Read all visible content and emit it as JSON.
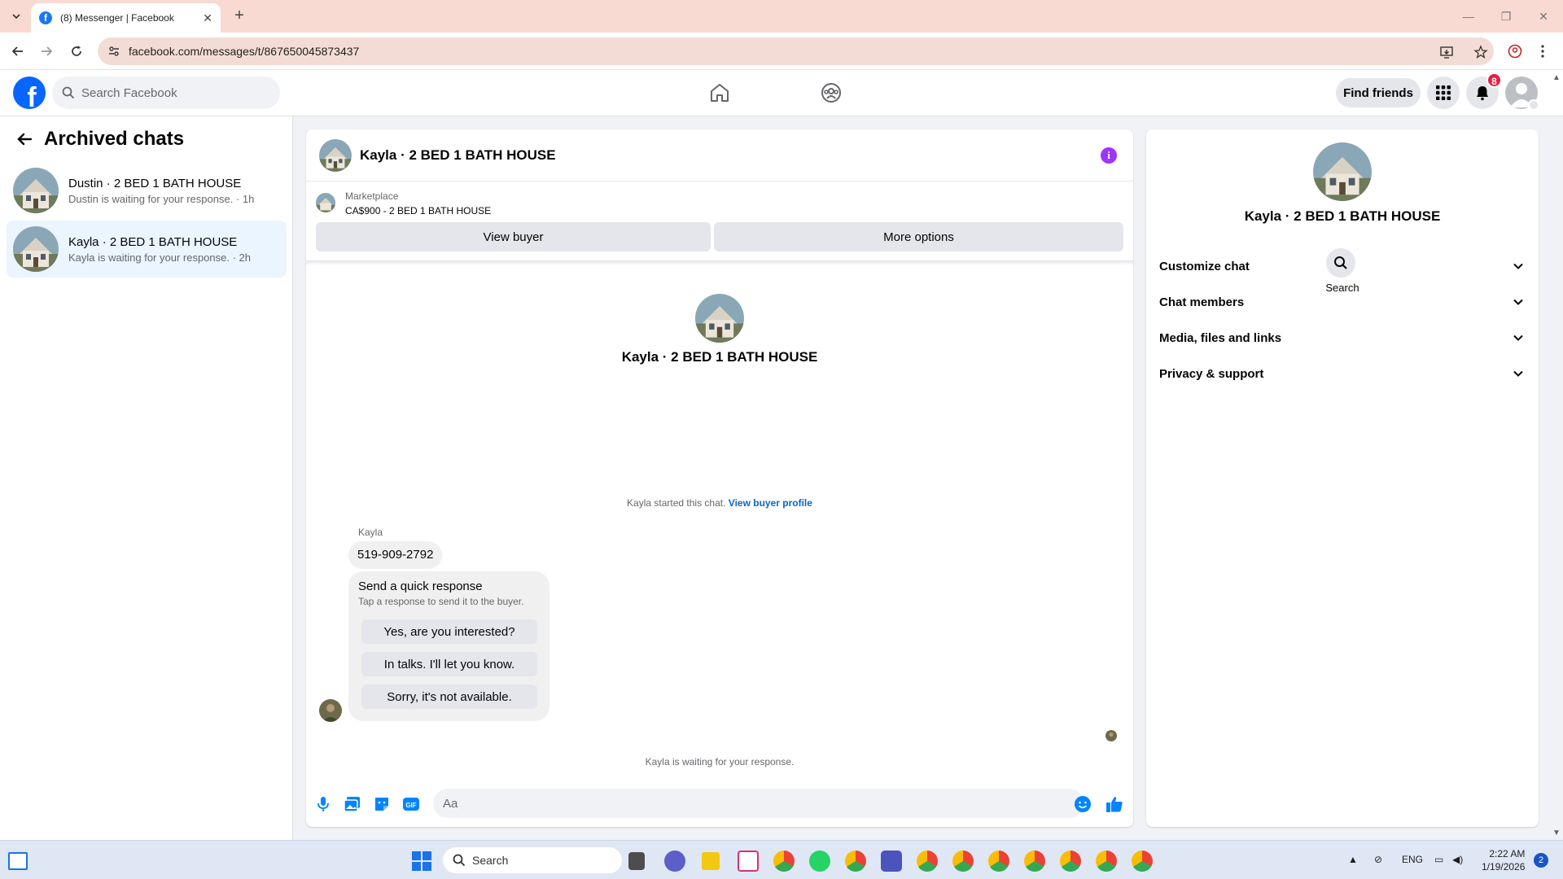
{
  "browser": {
    "tab_title": "(8) Messenger | Facebook",
    "url": "facebook.com/messages/t/867650045873437"
  },
  "header": {
    "search_placeholder": "Search Facebook",
    "find_friends_label": "Find friends",
    "notifications_count": "8"
  },
  "sidebar": {
    "title": "Archived chats",
    "conversations": [
      {
        "name": "Dustin · 2 BED 1 BATH HOUSE",
        "preview": "Dustin is waiting for your response. · 1h",
        "active": false
      },
      {
        "name": "Kayla · 2 BED 1 BATH HOUSE",
        "preview": "Kayla is waiting for your response. · 2h",
        "active": true
      }
    ]
  },
  "chat": {
    "title": "Kayla · 2 BED 1 BATH HOUSE",
    "marketplace_label": "Marketplace",
    "listing": "CA$900 - 2 BED 1 BATH HOUSE",
    "view_buyer_label": "View buyer",
    "more_options_label": "More options",
    "intro_name": "Kayla · 2 BED 1 BATH HOUSE",
    "started_text": "Kayla started this chat.",
    "view_profile_link": "View buyer profile",
    "sender": "Kayla",
    "message": "519-909-2792",
    "quick_response_title": "Send a quick response",
    "quick_response_subtitle": "Tap a response to send it to the buyer.",
    "quick_responses": [
      "Yes, are you interested?",
      "In talks. I'll let you know.",
      "Sorry, it's not available."
    ],
    "waiting_text": "Kayla is waiting for your response.",
    "composer_placeholder": "Aa"
  },
  "details": {
    "name": "Kayla · 2 BED 1 BATH HOUSE",
    "search_label": "Search",
    "sections": [
      "Customize chat",
      "Chat members",
      "Media, files and links",
      "Privacy & support"
    ]
  },
  "taskbar": {
    "search_label": "Search",
    "language": "ENG",
    "time": "2:22 AM",
    "date": "1/19/2026",
    "notification_count": "2"
  },
  "colors": {
    "facebook_blue": "#0866ff",
    "messenger_blue": "#0084ff",
    "info_purple": "#a033ff",
    "badge_red": "#e41e3f",
    "active_row": "#ebf5ff",
    "tabstrip": "#f8dad3"
  }
}
